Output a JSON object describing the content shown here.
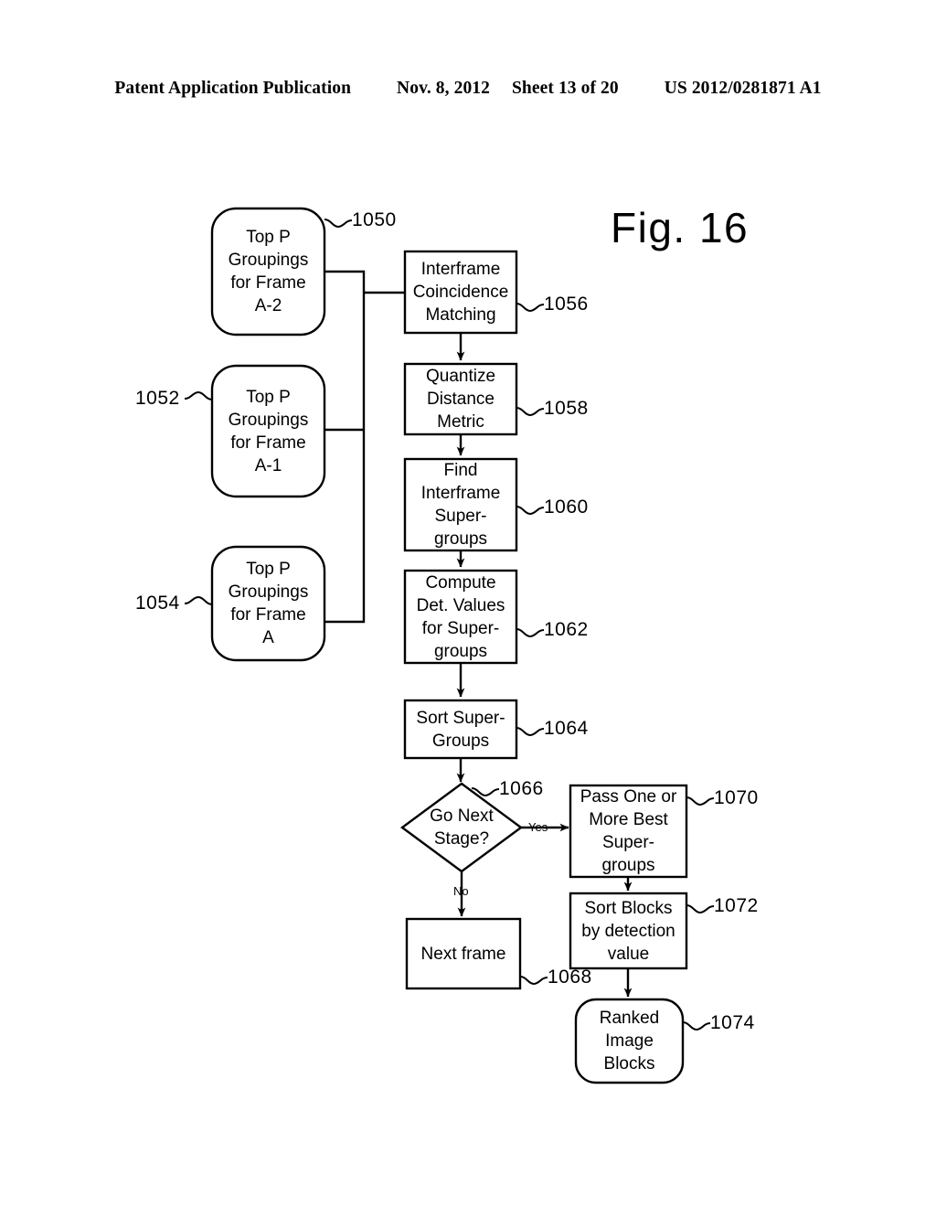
{
  "header": {
    "publication": "Patent Application Publication",
    "date": "Nov. 8, 2012",
    "sheet": "Sheet 13 of 20",
    "patent_number": "US 2012/0281871 A1"
  },
  "figure": {
    "title": "Fig. 16"
  },
  "nodes": {
    "top_p_a2": {
      "label": "Top P\nGroupings\nfor Frame\nA-2",
      "lines": [
        "Top P",
        "Groupings",
        "for Frame",
        "A-2"
      ],
      "ref": "1050",
      "shape": "rounded-rect"
    },
    "top_p_a1": {
      "label": "Top P\nGroupings\nfor Frame\nA-1",
      "lines": [
        "Top P",
        "Groupings",
        "for Frame",
        "A-1"
      ],
      "ref": "1052",
      "shape": "rounded-rect"
    },
    "top_p_a": {
      "label": "Top P\nGroupings\nfor Frame\nA",
      "lines": [
        "Top P",
        "Groupings",
        "for Frame",
        "A"
      ],
      "ref": "1054",
      "shape": "rounded-rect"
    },
    "interframe_matching": {
      "lines": [
        "Interframe",
        "Coincidence",
        "Matching"
      ],
      "ref": "1056",
      "shape": "rect"
    },
    "quantize_distance": {
      "lines": [
        "Quantize",
        "Distance",
        "Metric"
      ],
      "ref": "1058",
      "shape": "rect"
    },
    "find_supergroups": {
      "lines": [
        "Find",
        "Interframe",
        "Super-",
        "groups"
      ],
      "ref": "1060",
      "shape": "rect"
    },
    "compute_det_values": {
      "lines": [
        "Compute",
        "Det. Values",
        "for Super-",
        "groups"
      ],
      "ref": "1062",
      "shape": "rect"
    },
    "sort_supergroups": {
      "lines": [
        "Sort Super-",
        "Groups"
      ],
      "ref": "1064",
      "shape": "rect"
    },
    "go_next_stage": {
      "lines": [
        "Go Next",
        "Stage?"
      ],
      "ref": "1066",
      "shape": "diamond"
    },
    "next_frame": {
      "lines": [
        "Next frame"
      ],
      "ref": "1068",
      "shape": "rect"
    },
    "pass_best_supergroups": {
      "lines": [
        "Pass One or",
        "More Best",
        "Super-",
        "groups"
      ],
      "ref": "1070",
      "shape": "rect"
    },
    "sort_blocks": {
      "lines": [
        "Sort Blocks",
        "by detection",
        "value"
      ],
      "ref": "1072",
      "shape": "rect"
    },
    "ranked_image_blocks": {
      "lines": [
        "Ranked",
        "Image",
        "Blocks"
      ],
      "ref": "1074",
      "shape": "rounded-rect"
    }
  },
  "edge_labels": {
    "yes": "Yes",
    "no": "No"
  },
  "colors": {
    "stroke": "#000000",
    "background": "#ffffff"
  }
}
